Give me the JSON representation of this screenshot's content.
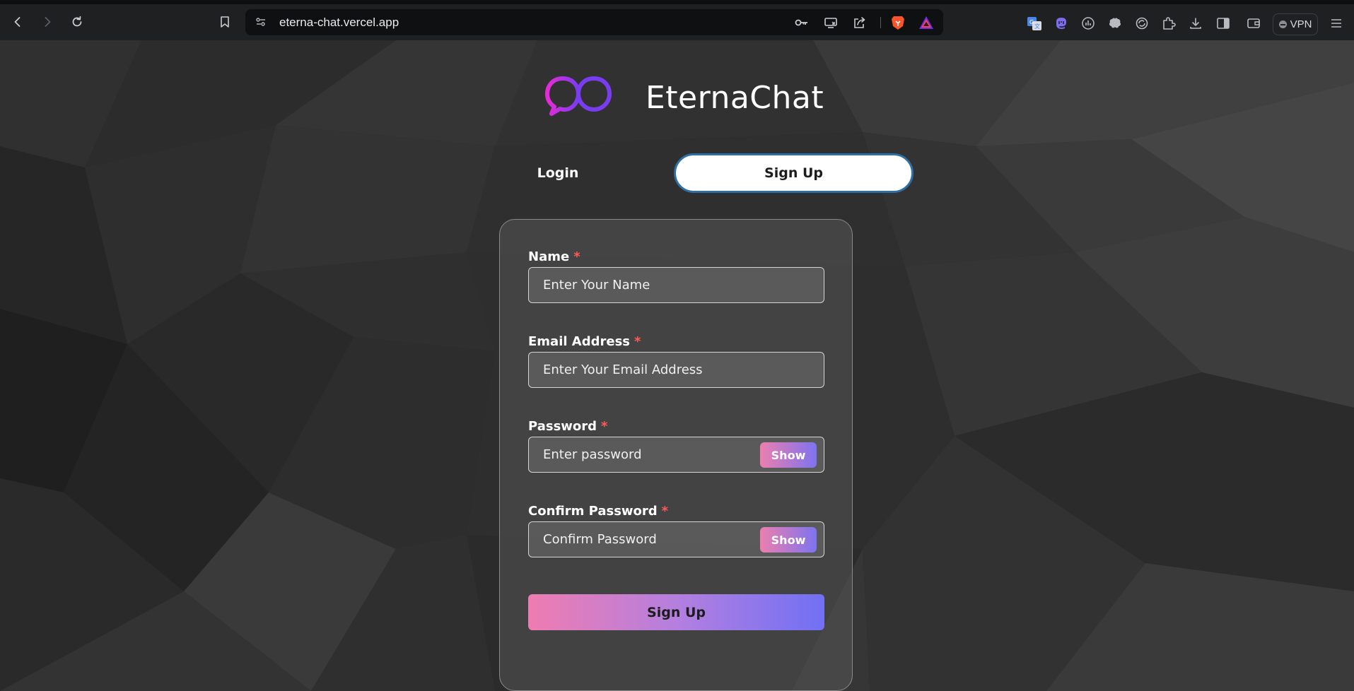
{
  "browser": {
    "url": "eterna-chat.vercel.app",
    "vpn_label": "VPN",
    "icons": {
      "back": "arrow-left-icon",
      "forward": "arrow-right-icon",
      "reload": "reload-icon",
      "bookmark": "bookmark-icon",
      "site_settings": "tune-icon",
      "passwords": "key-icon",
      "cast": "cast-icon",
      "share": "share-icon",
      "brave_shields": "brave-lion-icon",
      "brave_rewards": "triangle-icon",
      "menu": "hamburger-icon"
    }
  },
  "brand": {
    "name": "EternaChat",
    "logo_colors": [
      "#e62bd6",
      "#7a3cf0"
    ]
  },
  "tabs": {
    "login_label": "Login",
    "signup_label": "Sign Up",
    "active": "signup"
  },
  "form": {
    "name": {
      "label": "Name",
      "required_mark": "*",
      "placeholder": "Enter Your Name",
      "value": ""
    },
    "email": {
      "label": "Email Address",
      "required_mark": "*",
      "placeholder": "Enter Your Email Address",
      "value": ""
    },
    "password": {
      "label": "Password",
      "required_mark": "*",
      "placeholder": "Enter password",
      "value": "",
      "toggle_label": "Show"
    },
    "confirm": {
      "label": "Confirm Password",
      "required_mark": "*",
      "placeholder": "Confirm Password",
      "value": "",
      "toggle_label": "Show"
    },
    "submit_label": "Sign Up"
  },
  "colors": {
    "gradient_start": "#ef7cb0",
    "gradient_end": "#7170f4",
    "required": "#ff5a5a",
    "active_tab_border": "#2f6fa3"
  }
}
